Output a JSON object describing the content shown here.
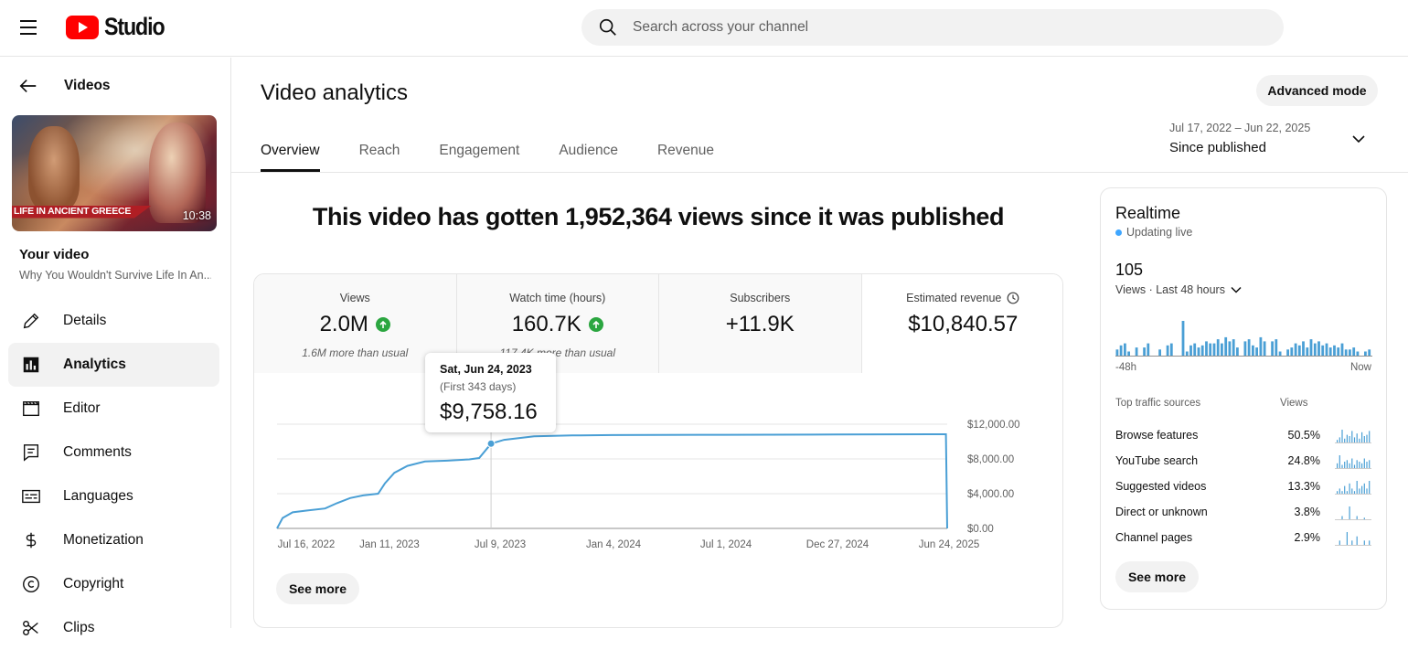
{
  "header": {
    "logo_text": "Studio",
    "search_placeholder": "Search across your channel"
  },
  "sidebar": {
    "back_label": "Videos",
    "thumbnail": {
      "banner_text": "LIFE IN ANCIENT GREECE",
      "duration": "10:38"
    },
    "your_video_label": "Your video",
    "video_title": "Why You Wouldn't Survive Life In An...",
    "items": [
      {
        "label": "Details",
        "icon": "pencil-icon"
      },
      {
        "label": "Analytics",
        "icon": "analytics-icon",
        "active": true
      },
      {
        "label": "Editor",
        "icon": "clapperboard-icon"
      },
      {
        "label": "Comments",
        "icon": "comment-icon"
      },
      {
        "label": "Languages",
        "icon": "subtitles-icon"
      },
      {
        "label": "Monetization",
        "icon": "dollar-icon"
      },
      {
        "label": "Copyright",
        "icon": "copyright-icon"
      },
      {
        "label": "Clips",
        "icon": "scissors-icon"
      }
    ]
  },
  "main": {
    "title": "Video analytics",
    "advanced_mode_label": "Advanced mode",
    "tabs": [
      "Overview",
      "Reach",
      "Engagement",
      "Audience",
      "Revenue"
    ],
    "active_tab": "Overview",
    "date_range": {
      "dates": "Jul 17, 2022 – Jun 22, 2025",
      "label": "Since published"
    },
    "headline": "This video has gotten 1,952,364 views since it was published",
    "metrics": [
      {
        "title": "Views",
        "value": "2.0M",
        "trend": "up",
        "sub": "1.6M more than usual"
      },
      {
        "title": "Watch time (hours)",
        "value": "160.7K",
        "trend": "up",
        "sub": "117.4K more than usual"
      },
      {
        "title": "Subscribers",
        "value": "+11.9K",
        "trend": "",
        "sub": ""
      },
      {
        "title": "Estimated revenue",
        "value": "$10,840.57",
        "trend": "",
        "sub": ""
      }
    ],
    "tooltip": {
      "date": "Sat, Jun 24, 2023",
      "period": "(First 343 days)",
      "value": "$9,758.16"
    },
    "see_more_label": "See more"
  },
  "chart_data": {
    "type": "line",
    "title": "Estimated revenue",
    "x_tick_labels": [
      "Jul 16, 2022",
      "Jan 11, 2023",
      "Jul 9, 2023",
      "Jan 4, 2024",
      "Jul 1, 2024",
      "Dec 27, 2024",
      "Jun 24, 2025"
    ],
    "y_tick_labels": [
      "$12,000.00",
      "$8,000.00",
      "$4,000.00",
      "$0.00"
    ],
    "ylim": [
      0,
      12000
    ],
    "xlim": [
      "2022-07-16",
      "2025-06-24"
    ],
    "series": [
      {
        "points": [
          [
            "2022-07-16",
            0
          ],
          [
            "2022-07-25",
            1200
          ],
          [
            "2022-08-10",
            1850
          ],
          [
            "2022-09-01",
            2050
          ],
          [
            "2022-10-01",
            2300
          ],
          [
            "2022-10-20",
            2900
          ],
          [
            "2022-11-10",
            3500
          ],
          [
            "2022-12-01",
            3800
          ],
          [
            "2022-12-25",
            4000
          ],
          [
            "2023-01-05",
            5200
          ],
          [
            "2023-01-20",
            6400
          ],
          [
            "2023-02-10",
            7200
          ],
          [
            "2023-03-10",
            7700
          ],
          [
            "2023-04-15",
            7800
          ],
          [
            "2023-05-20",
            7950
          ],
          [
            "2023-06-05",
            8100
          ],
          [
            "2023-06-24",
            9758
          ],
          [
            "2023-07-15",
            10200
          ],
          [
            "2023-09-01",
            10600
          ],
          [
            "2023-11-01",
            10700
          ],
          [
            "2024-01-04",
            10750
          ],
          [
            "2024-07-01",
            10780
          ],
          [
            "2024-12-27",
            10810
          ],
          [
            "2025-06-22",
            10840
          ],
          [
            "2025-06-24",
            0
          ]
        ]
      }
    ],
    "highlight": {
      "x": "2023-06-24",
      "y": 9758.16
    },
    "grid": true
  },
  "realtime": {
    "title": "Realtime",
    "live_label": "Updating live",
    "count": "105",
    "range_label": "Views · Last 48 hours",
    "axis_start": "-48h",
    "axis_end": "Now",
    "bars": [
      3,
      5,
      6,
      2,
      0,
      4,
      0,
      4,
      6,
      0,
      0,
      3,
      0,
      5,
      6,
      0,
      0,
      17,
      2,
      5,
      6,
      4,
      5,
      7,
      6,
      6,
      8,
      6,
      9,
      7,
      8,
      4,
      0,
      7,
      8,
      5,
      4,
      9,
      7,
      0,
      7,
      8,
      2,
      0,
      3,
      4,
      6,
      5,
      7,
      4,
      8,
      6,
      7,
      5,
      6,
      4,
      5,
      4,
      6,
      3,
      3,
      4,
      2,
      0,
      2,
      3
    ],
    "sources_header": "Top traffic sources",
    "views_header": "Views",
    "sources": [
      {
        "name": "Browse features",
        "pct": "50.5%",
        "spark": [
          2,
          4,
          10,
          3,
          6,
          5,
          9,
          4,
          7,
          3,
          8,
          5,
          6,
          9
        ]
      },
      {
        "name": "YouTube search",
        "pct": "24.8%",
        "spark": [
          3,
          8,
          2,
          4,
          5,
          3,
          6,
          2,
          5,
          4,
          3,
          6,
          4,
          5
        ]
      },
      {
        "name": "Suggested videos",
        "pct": "13.3%",
        "spark": [
          1,
          2,
          1,
          3,
          1,
          4,
          2,
          1,
          5,
          2,
          3,
          4,
          2,
          5
        ]
      },
      {
        "name": "Direct or unknown",
        "pct": "3.8%",
        "spark": [
          0,
          0,
          2,
          0,
          0,
          8,
          0,
          0,
          2,
          0,
          0,
          1,
          0,
          0
        ]
      },
      {
        "name": "Channel pages",
        "pct": "2.9%",
        "spark": [
          0,
          1,
          0,
          0,
          3,
          0,
          1,
          0,
          2,
          0,
          0,
          1,
          0,
          1
        ]
      }
    ],
    "see_more_label": "See more"
  }
}
